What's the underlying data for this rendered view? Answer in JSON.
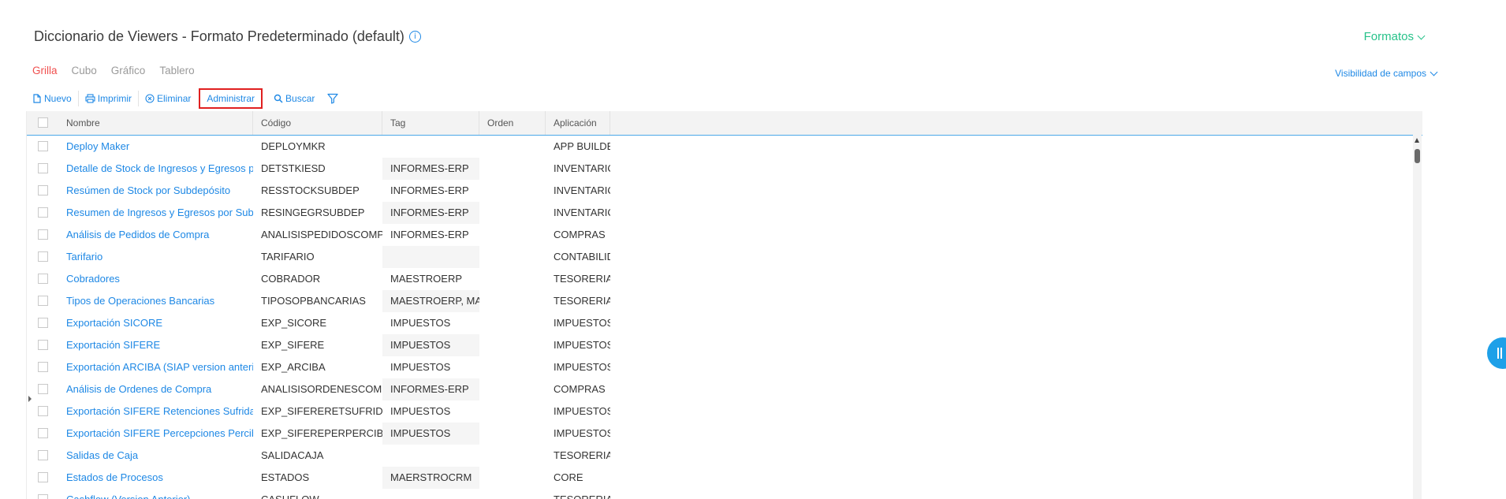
{
  "header": {
    "title": "Diccionario de Viewers - Formato Predeterminado (default)",
    "info_icon": "i",
    "formatos_label": "Formatos"
  },
  "tabs": [
    {
      "label": "Grilla",
      "active": true
    },
    {
      "label": "Cubo",
      "active": false
    },
    {
      "label": "Gráfico",
      "active": false
    },
    {
      "label": "Tablero",
      "active": false
    }
  ],
  "visibilidad_label": "Visibilidad de campos",
  "toolbar": {
    "nuevo": "Nuevo",
    "imprimir": "Imprimir",
    "eliminar": "Eliminar",
    "administrar": "Administrar",
    "buscar": "Buscar"
  },
  "grid": {
    "columns": [
      "Nombre",
      "Código",
      "Tag",
      "Orden",
      "Aplicación"
    ],
    "rows": [
      {
        "nombre": "Deploy Maker",
        "codigo": "DEPLOYMKR",
        "tag": "",
        "orden": "",
        "aplicacion": "APP BUILDER"
      },
      {
        "nombre": "Detalle de Stock de Ingresos y Egresos por Subdepósito",
        "codigo": "DETSTKIESD",
        "tag": "INFORMES-ERP",
        "orden": "",
        "aplicacion": "INVENTARIOS"
      },
      {
        "nombre": "Resúmen de Stock por Subdepósito",
        "codigo": "RESSTOCKSUBDEP",
        "tag": "INFORMES-ERP",
        "orden": "",
        "aplicacion": "INVENTARIOS"
      },
      {
        "nombre": "Resumen de Ingresos y Egresos por Subdepósito",
        "codigo": "RESINGEGRSUBDEP",
        "tag": "INFORMES-ERP",
        "orden": "",
        "aplicacion": "INVENTARIOS"
      },
      {
        "nombre": "Análisis de Pedidos de Compra",
        "codigo": "ANALISISPEDIDOSCOMPRA",
        "tag": "INFORMES-ERP",
        "orden": "",
        "aplicacion": "COMPRAS"
      },
      {
        "nombre": "Tarifario",
        "codigo": "TARIFARIO",
        "tag": "",
        "orden": "",
        "aplicacion": "CONTABILIDAD"
      },
      {
        "nombre": "Cobradores",
        "codigo": "COBRADOR",
        "tag": "MAESTROERP",
        "orden": "",
        "aplicacion": "TESORERIA Y"
      },
      {
        "nombre": "Tipos de Operaciones Bancarias",
        "codigo": "TIPOSOPBANCARIAS",
        "tag": "MAESTROERP, MAESTROCRM",
        "orden": "",
        "aplicacion": "TESORERIA Y"
      },
      {
        "nombre": "Exportación SICORE",
        "codigo": "EXP_SICORE",
        "tag": "IMPUESTOS",
        "orden": "",
        "aplicacion": "IMPUESTOS_AR"
      },
      {
        "nombre": "Exportación SIFERE",
        "codigo": "EXP_SIFERE",
        "tag": "IMPUESTOS",
        "orden": "",
        "aplicacion": "IMPUESTOS_AR"
      },
      {
        "nombre": "Exportación ARCIBA (SIAP version anterior)",
        "codigo": "EXP_ARCIBA",
        "tag": "IMPUESTOS",
        "orden": "",
        "aplicacion": "IMPUESTOS_AR"
      },
      {
        "nombre": "Análisis de Ordenes de Compra",
        "codigo": "ANALISISORDENESCOMPRA",
        "tag": "INFORMES-ERP",
        "orden": "",
        "aplicacion": "COMPRAS"
      },
      {
        "nombre": "Exportación SIFERE Retenciones Sufridas",
        "codigo": "EXP_SIFERERETSUFRIDAS",
        "tag": "IMPUESTOS",
        "orden": "",
        "aplicacion": "IMPUESTOS_AR"
      },
      {
        "nombre": "Exportación SIFERE Percepciones Percibidas",
        "codigo": "EXP_SIFEREPERPERCIBIDAS",
        "tag": "IMPUESTOS",
        "orden": "",
        "aplicacion": "IMPUESTOS_AR"
      },
      {
        "nombre": "Salidas de Caja",
        "codigo": "SALIDACAJA",
        "tag": "",
        "orden": "",
        "aplicacion": "TESORERIA Y"
      },
      {
        "nombre": "Estados de Procesos",
        "codigo": "ESTADOS",
        "tag": "MAERSTROCRM",
        "orden": "",
        "aplicacion": "CORE"
      },
      {
        "nombre": "Cashflow (Version Anterior)",
        "codigo": "CASHFLOW",
        "tag": "",
        "orden": "",
        "aplicacion": "TESORERIA Y"
      }
    ]
  },
  "colors": {
    "accent": "#1e88e5",
    "active_tab": "#f0504f",
    "formatos": "#27c28a"
  }
}
